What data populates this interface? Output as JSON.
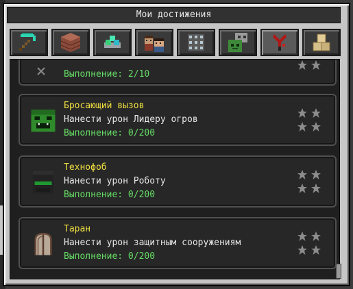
{
  "window": {
    "title": "Мои достижения"
  },
  "tabs": [
    {
      "icon": "pickaxe-icon"
    },
    {
      "icon": "brick-block-icon"
    },
    {
      "icon": "gems-icon"
    },
    {
      "icon": "villagers-icon"
    },
    {
      "icon": "grid-block-icon"
    },
    {
      "icon": "zombie-face-icon"
    },
    {
      "icon": "bloody-tool-icon",
      "active": true
    },
    {
      "icon": "sand-blocks-icon"
    }
  ],
  "partial_card": {
    "progress": "Выполнение: 2/10"
  },
  "achievements": [
    {
      "title": "Бросающий вызов",
      "description": "Нанести урон Лидеру огров",
      "progress": "Выполнение: 0/200",
      "icon": "ogre-leader-icon"
    },
    {
      "title": "Технофоб",
      "description": "Нанести урон Роботу",
      "progress": "Выполнение: 0/200",
      "icon": "robot-icon"
    },
    {
      "title": "Таран",
      "description": "Нанести урон защитным сооружениям",
      "progress": "Выполнение: 0/200",
      "icon": "wooden-gate-icon"
    }
  ],
  "colors": {
    "title": "#f0e040",
    "progress": "#66dd66",
    "star": "#8c8c8c"
  }
}
